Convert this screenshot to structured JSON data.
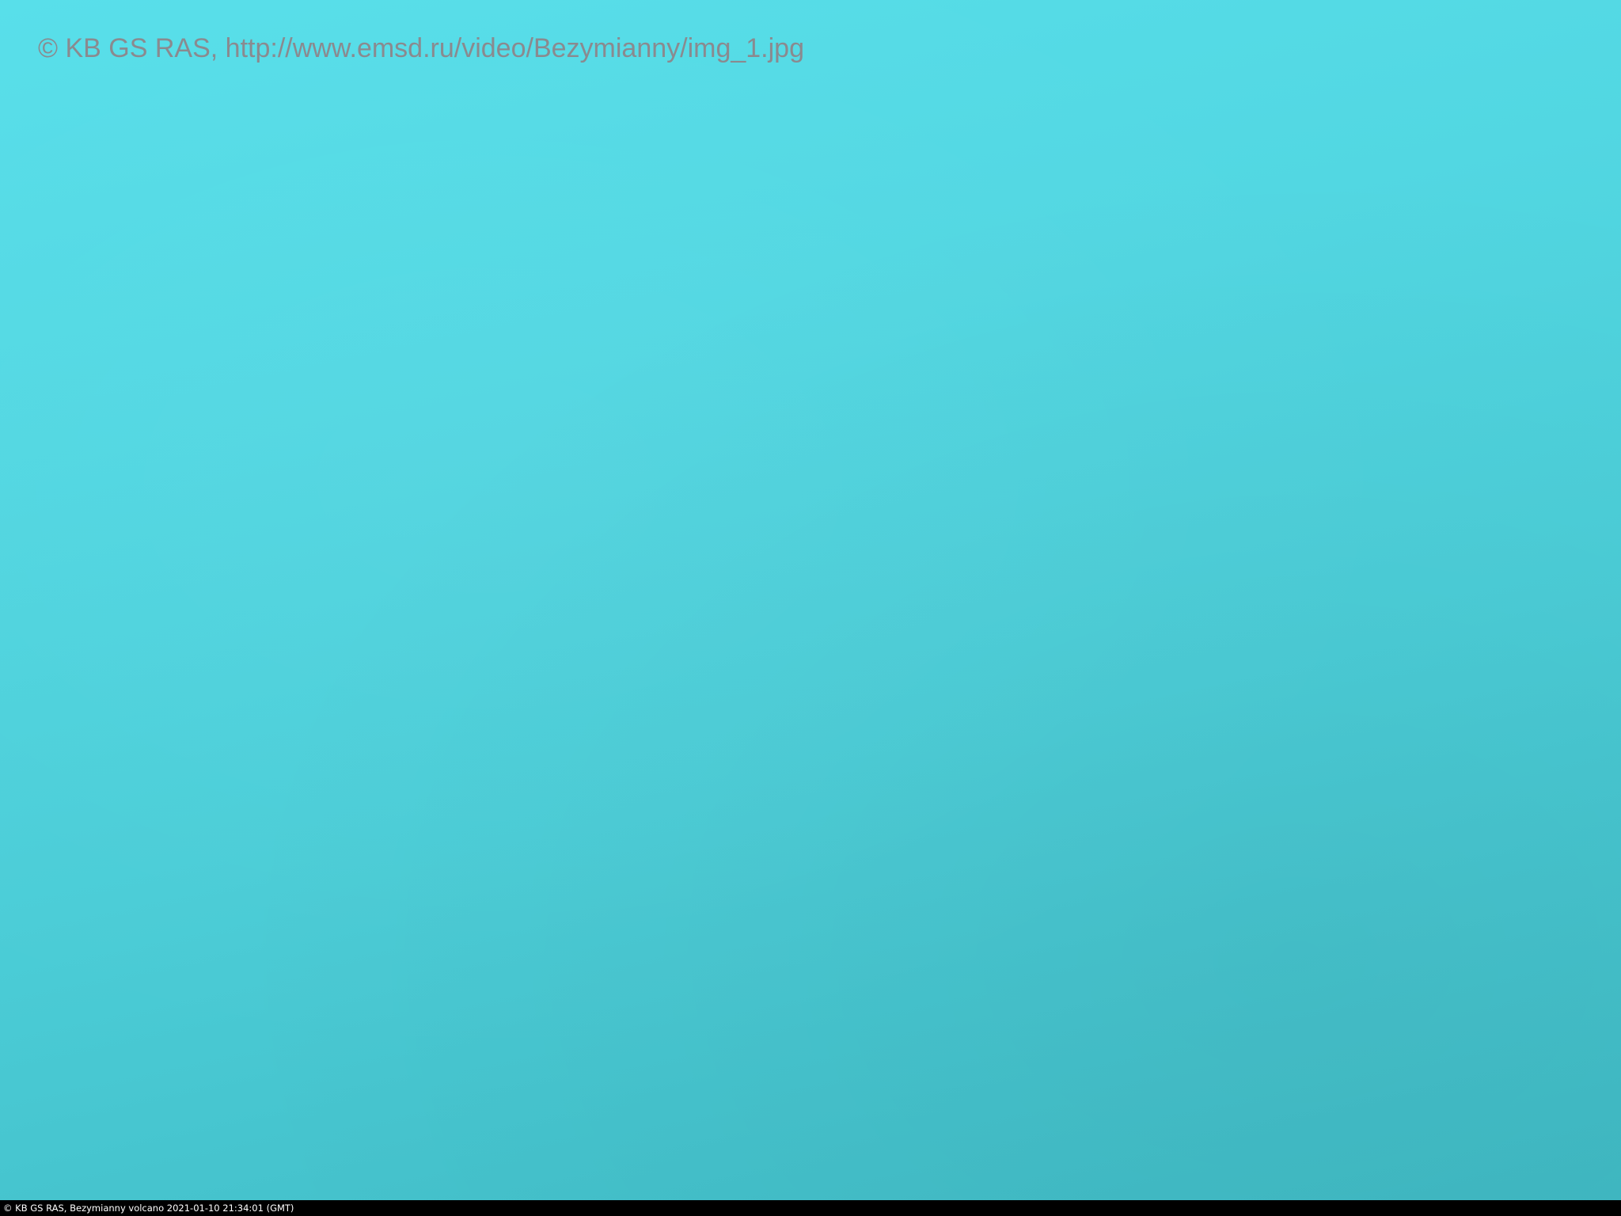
{
  "watermark": {
    "text": "© KB GS RAS, http://www.emsd.ru/video/Bezymianny/img_1.jpg",
    "color": "#8a8a8f"
  },
  "caption": {
    "text": "© KB GS RAS, Bezymianny volcano 2021-01-10 21:34:01 (GMT)",
    "background": "#000000",
    "color": "#ffffff"
  },
  "scene": {
    "sky_color_top": "#58dfea",
    "sky_color_bottom": "#40bac4"
  }
}
